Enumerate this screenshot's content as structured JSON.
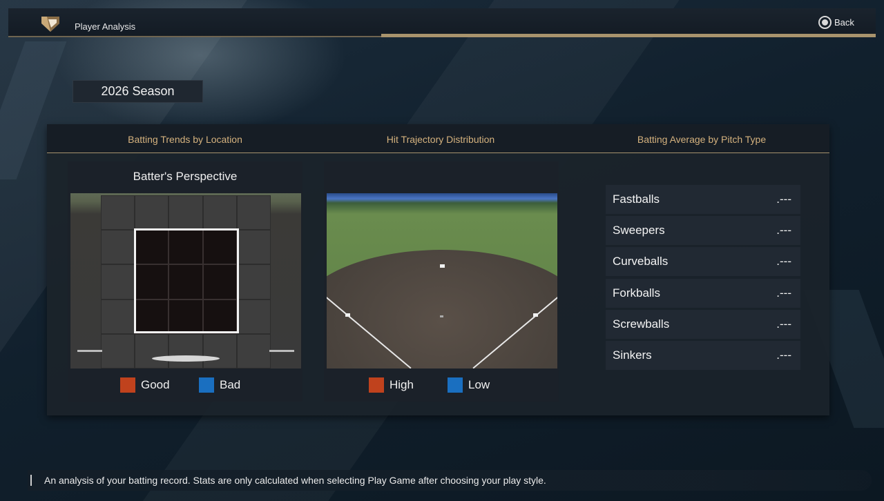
{
  "header": {
    "title": "Player Analysis",
    "back_label": "Back"
  },
  "season_tab": {
    "label": "2026 Season"
  },
  "panel": {
    "columns": [
      {
        "label": "Batting Trends by Location"
      },
      {
        "label": "Hit Trajectory Distribution"
      },
      {
        "label": "Batting Average by Pitch Type"
      }
    ],
    "batter_perspective": {
      "title": "Batter's Perspective",
      "legend": [
        {
          "label": "Good",
          "color": "#c0421d"
        },
        {
          "label": "Bad",
          "color": "#1a6fc0"
        }
      ]
    },
    "trajectory": {
      "legend": [
        {
          "label": "High",
          "color": "#c0421d"
        },
        {
          "label": "Low",
          "color": "#1a6fc0"
        }
      ]
    },
    "pitch_types": [
      {
        "name": "Fastballs",
        "value": ".---"
      },
      {
        "name": "Sweepers",
        "value": ".---"
      },
      {
        "name": "Curveballs",
        "value": ".---"
      },
      {
        "name": "Forkballs",
        "value": ".---"
      },
      {
        "name": "Screwballs",
        "value": ".---"
      },
      {
        "name": "Sinkers",
        "value": ".---"
      }
    ]
  },
  "footer": {
    "help_text": "An analysis of your batting record. Stats are only calculated when selecting Play Game after choosing your play style."
  },
  "colors": {
    "accent_gold": "#a8936d",
    "heading_gold": "#d5b27e"
  }
}
